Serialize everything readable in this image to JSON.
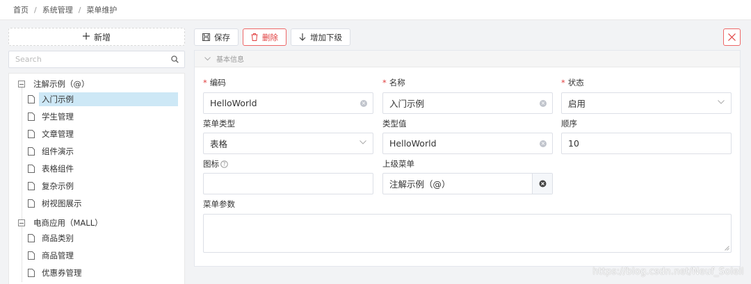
{
  "breadcrumb": {
    "home": "首页",
    "sep": "/",
    "section": "系统管理",
    "current": "菜单维护"
  },
  "left": {
    "add_label": "新增",
    "search_placeholder": "Search"
  },
  "tree": {
    "group1": {
      "label": "注解示例（@）",
      "children": [
        "入门示例",
        "学生管理",
        "文章管理",
        "组件演示",
        "表格组件",
        "复杂示例",
        "树视图展示"
      ]
    },
    "group2": {
      "label": "电商应用（MALL）",
      "children": [
        "商品类别",
        "商品管理",
        "优惠券管理"
      ]
    }
  },
  "toolbar": {
    "save": "保存",
    "delete": "删除",
    "add_child": "增加下级"
  },
  "panel": {
    "title": "基本信息"
  },
  "form": {
    "code": {
      "label": "编码",
      "value": "HelloWorld"
    },
    "name": {
      "label": "名称",
      "value": "入门示例"
    },
    "status": {
      "label": "状态",
      "value": "启用"
    },
    "menu_type": {
      "label": "菜单类型",
      "value": "表格"
    },
    "type_value": {
      "label": "类型值",
      "value": "HelloWorld"
    },
    "order": {
      "label": "顺序",
      "value": "10"
    },
    "icon": {
      "label": "图标",
      "value": ""
    },
    "parent": {
      "label": "上级菜单",
      "value": "注解示例（@）"
    },
    "params": {
      "label": "菜单参数",
      "value": ""
    }
  },
  "watermark": "https://blog.csdn.net/Neuf_Soleil",
  "colors": {
    "danger": "#e03e3e",
    "selected_bg": "#cde8f6",
    "border": "#dcdfe6"
  }
}
